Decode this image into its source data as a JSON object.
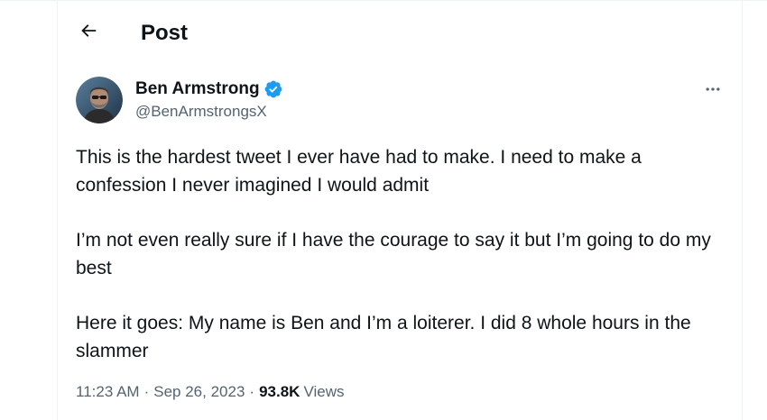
{
  "header": {
    "back_icon": "arrow-left-icon",
    "title": "Post"
  },
  "author": {
    "display_name": "Ben Armstrong",
    "verified": true,
    "verified_icon": "verified-badge-icon",
    "verified_color": "#1d9bf0",
    "handle": "@BenArmstrongsX",
    "avatar_icon": "avatar-photo"
  },
  "more_icon": "more-horizontal-icon",
  "tweet": {
    "paragraphs": [
      "This is the hardest tweet I ever have had to make. I need to make a confession I never imagined I would admit",
      "I’m not even really sure if I have the courage to say it but I’m going to do my best",
      "Here it goes: My name is Ben and I’m a loiterer. I did 8 whole hours in the slammer"
    ]
  },
  "meta": {
    "time": "11:23 AM",
    "separator": "·",
    "date": "Sep 26, 2023",
    "views_count": "93.8K",
    "views_label": "Views"
  },
  "colors": {
    "text_primary": "#0f1419",
    "text_secondary": "#536471",
    "border": "#eff3f4",
    "accent": "#1d9bf0"
  }
}
